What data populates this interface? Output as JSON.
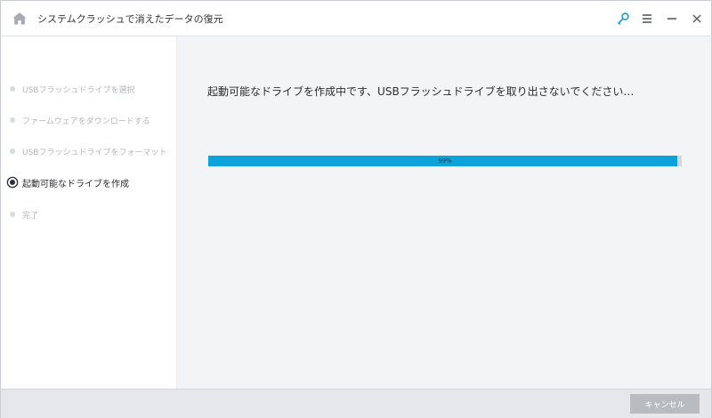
{
  "window": {
    "title": "システムクラッシュで消えたデータの復元"
  },
  "titlebar_icons": [
    "home-icon",
    "key-icon",
    "menu-icon",
    "minimize-icon",
    "close-icon"
  ],
  "colors": {
    "accent": "#0ba3d9",
    "progress_track": "#d5d7db",
    "main_bg": "#f3f4f6",
    "inactive_step": "#b3b6ba",
    "active_step": "#2a2d31"
  },
  "sidebar": {
    "steps": [
      {
        "label": "USBフラッシュドライブを選択",
        "state": "done"
      },
      {
        "label": "ファームウェアをダウンロードする",
        "state": "done"
      },
      {
        "label": "USBフラッシュドライブをフォーマット",
        "state": "done"
      },
      {
        "label": "起動可能なドライブを作成",
        "state": "active"
      },
      {
        "label": "完了",
        "state": "pending"
      }
    ]
  },
  "main": {
    "message": "起動可能なドライブを作成中です、USBフラッシュドライブを取り出さないでください…",
    "progress": {
      "value": 0.99,
      "label": "99%"
    }
  },
  "footer": {
    "cancel_label": "キャンセル"
  }
}
